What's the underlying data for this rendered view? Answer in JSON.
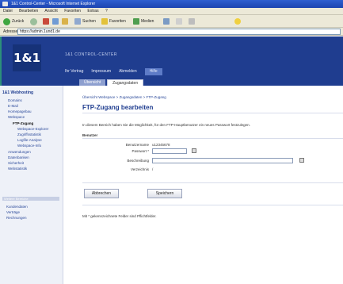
{
  "window": {
    "title": "1&1 Control-Center - Microsoft Internet Explorer"
  },
  "menu": [
    "Datei",
    "Bearbeiten",
    "Ansicht",
    "Favoriten",
    "Extras",
    "?"
  ],
  "toolbar": {
    "back": "Zurück",
    "search": "Suchen",
    "favorites": "Favoriten",
    "media": "Medien"
  },
  "address": {
    "label": "Adresse",
    "value": "https://admin.1und1.de"
  },
  "header": {
    "logo": "1&1",
    "title": "1&1 CONTROL-CENTER",
    "nav": [
      "Ihr Vertrag",
      "Impressum",
      "Abmelden"
    ],
    "nav_active": "Hilfe"
  },
  "tabs": {
    "inactive": "Übersicht",
    "active": "Zugangsdaten"
  },
  "sidebar": {
    "title": "1&1 Webhosting",
    "items": [
      "Domains",
      "E-Mail",
      "Homepagebau",
      "Webspace"
    ],
    "current": "FTP-Zugang",
    "subitems": [
      "Webspace-Explorer",
      "Zugriffsstatistik",
      "Logfile-Analyse",
      "Webspace-Info"
    ],
    "more": [
      "Anwendungen",
      "Datenbanken",
      "Sicherheit",
      "Webstatistik"
    ],
    "section2": "Weitere Bereiche",
    "links": [
      "Kundendaten",
      "Verträge",
      "Rechnungen"
    ]
  },
  "breadcrumb": "Übersicht Webspace > Zugangsdaten > FTP-Zugang",
  "page": {
    "title": "FTP-Zugang bearbeiten",
    "intro": "In diesem Bereich haben Sie die Möglichkeit, für den FTP-Hauptbenutzer ein neues Passwort festzulegen.",
    "section": "Benutzer",
    "fields": {
      "user_label": "Benutzername",
      "user_value": "u12345678",
      "password_label": "Passwort *",
      "description_label": "Beschreibung",
      "directory_label": "Verzeichnis",
      "directory_value": "/"
    },
    "buttons": {
      "back": "Abbrechen",
      "save": "Speichern"
    },
    "footnote": "Mit * gekennzeichnete Felder sind Pflichtfelder."
  },
  "colors": {
    "header": "#1f3d8f",
    "sidebar_bg": "#eef1f8",
    "link": "#2c4a9a"
  }
}
